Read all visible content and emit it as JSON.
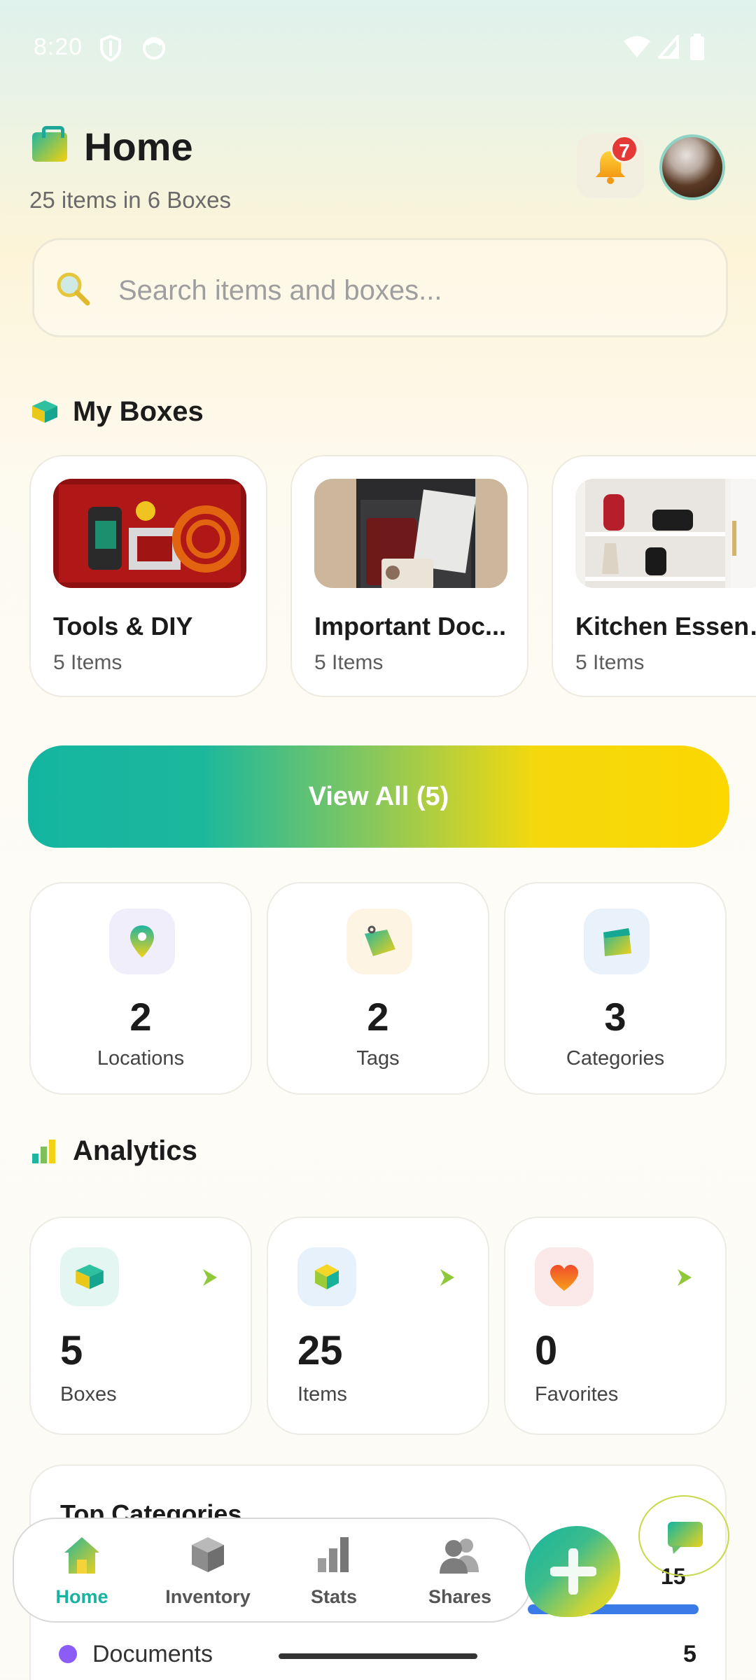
{
  "status_bar": {
    "time": "8:20"
  },
  "header": {
    "title": "Home",
    "subtitle": "25 items in 6 Boxes",
    "notification_count": "7"
  },
  "search": {
    "placeholder": "Search items and boxes..."
  },
  "my_boxes": {
    "title": "My Boxes",
    "items": [
      {
        "name": "Tools & DIY",
        "count": "5 Items"
      },
      {
        "name": "Important Doc...",
        "count": "5 Items"
      },
      {
        "name": "Kitchen Essent...",
        "count": "5 Items"
      }
    ]
  },
  "view_all_label": "View All (5)",
  "stats": [
    {
      "value": "2",
      "label": "Locations",
      "icon": "location-pin-icon"
    },
    {
      "value": "2",
      "label": "Tags",
      "icon": "tag-icon"
    },
    {
      "value": "3",
      "label": "Categories",
      "icon": "folder-icon"
    }
  ],
  "analytics": {
    "title": "Analytics",
    "cards": [
      {
        "value": "5",
        "label": "Boxes",
        "icon": "box-icon"
      },
      {
        "value": "25",
        "label": "Items",
        "icon": "cube-icon"
      },
      {
        "value": "0",
        "label": "Favorites",
        "icon": "heart-icon"
      }
    ]
  },
  "top_categories": {
    "title": "Top Categories",
    "first_count": "15",
    "rows": [
      {
        "name": "Documents",
        "count": "5"
      }
    ]
  },
  "nav": {
    "items": [
      {
        "label": "Home",
        "active": true
      },
      {
        "label": "Inventory"
      },
      {
        "label": "Stats"
      },
      {
        "label": "Shares"
      }
    ]
  },
  "colors": {
    "accent_teal": "#17b3a0",
    "accent_yellow": "#fcd700",
    "badge_red": "#e53935"
  }
}
